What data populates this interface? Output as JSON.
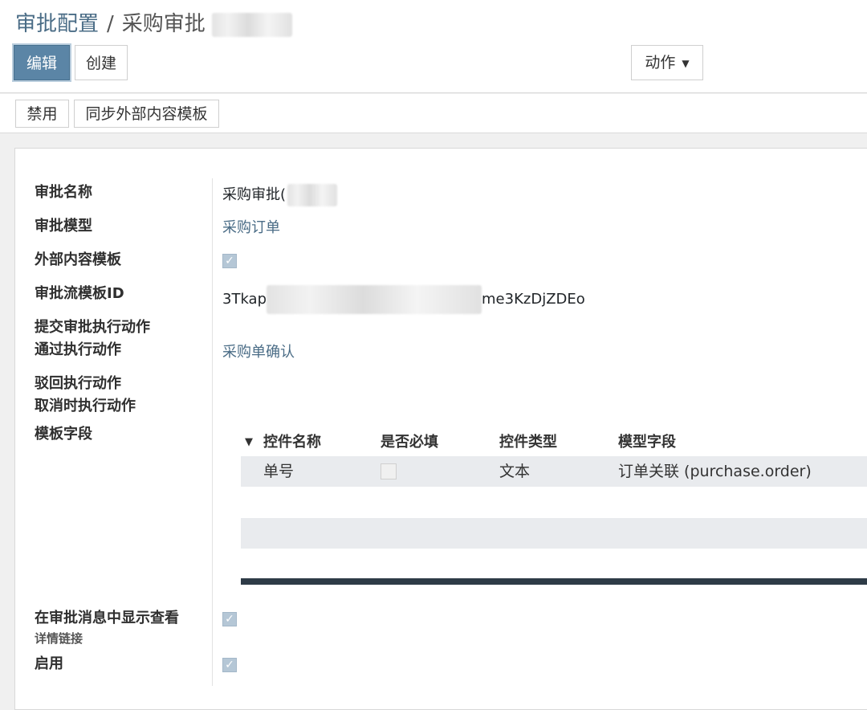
{
  "breadcrumb": {
    "parent": "审批配置",
    "separator": "/",
    "current": "采购审批"
  },
  "toolbar": {
    "edit_label": "编辑",
    "create_label": "创建",
    "action_label": "动作"
  },
  "status_bar": {
    "disable_label": "禁用",
    "sync_label": "同步外部内容模板"
  },
  "form": {
    "approval_name": {
      "label": "审批名称",
      "value": "采购审批("
    },
    "approval_model": {
      "label": "审批模型",
      "value": "采购订单"
    },
    "external_template": {
      "label": "外部内容模板",
      "checked": true
    },
    "flow_template_id": {
      "label": "审批流模板ID",
      "value_prefix": "3Tkap",
      "value_suffix": "me3KzDjZDEo"
    },
    "submit_action": {
      "label": "提交审批执行动作",
      "value": ""
    },
    "pass_action": {
      "label": "通过执行动作",
      "value": "采购单确认"
    },
    "reject_action": {
      "label": "驳回执行动作",
      "value": ""
    },
    "cancel_action": {
      "label": "取消时执行动作",
      "value": ""
    },
    "template_fields": {
      "label": "模板字段"
    },
    "show_detail_link": {
      "label_line1": "在审批消息中显示查看",
      "label_line2": "详情链接",
      "checked": true
    },
    "enabled": {
      "label": "启用",
      "checked": true
    }
  },
  "fields_table": {
    "headers": [
      "控件名称",
      "是否必填",
      "控件类型",
      "模型字段"
    ],
    "rows": [
      {
        "name": "单号",
        "required": false,
        "type": "文本",
        "model_field": "订单关联 (purchase.order)"
      }
    ]
  },
  "colors": {
    "primary": "#5b85a6",
    "link": "#4a6c86",
    "checkbox_checked": "#b5c7d6",
    "table_row": "#e9ebee",
    "table_rule": "#2e3b47"
  }
}
